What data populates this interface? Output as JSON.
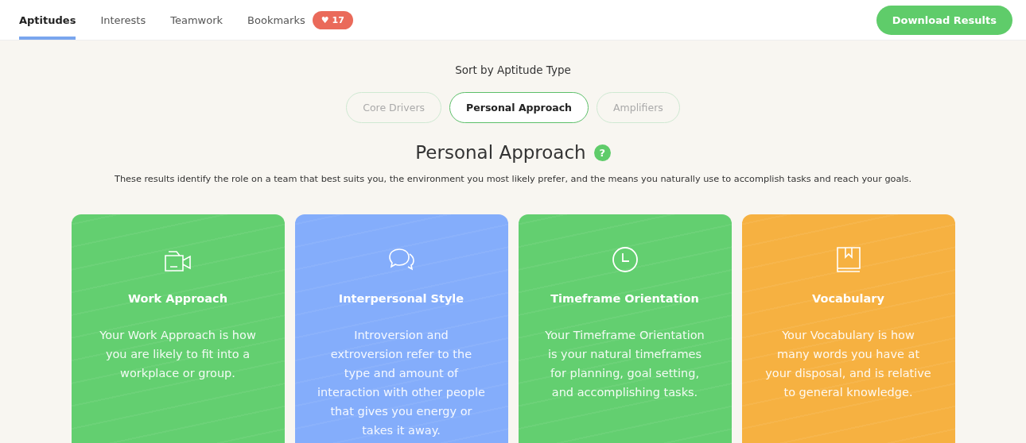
{
  "tabs": [
    {
      "label": "Aptitudes",
      "selected": true
    },
    {
      "label": "Interests",
      "selected": false
    },
    {
      "label": "Teamwork",
      "selected": false
    },
    {
      "label": "Bookmarks",
      "selected": false
    }
  ],
  "bookmarks_badge": {
    "icon": "♥",
    "count": "17"
  },
  "download_button": "Download Results",
  "sort": {
    "heading": "Sort by Aptitude Type",
    "options": [
      {
        "label": "Core Drivers",
        "selected": false
      },
      {
        "label": "Personal Approach",
        "selected": true
      },
      {
        "label": "Amplifiers",
        "selected": false
      }
    ]
  },
  "section": {
    "title": "Personal Approach",
    "help": "?",
    "description": "These results identify the role on a team that best suits you, the environment you most likely prefer, and the means you naturally use to accomplish tasks and reach your goals."
  },
  "cards": [
    {
      "kind": "camera",
      "color": "#63cf70",
      "title": "Work Approach",
      "text": "Your Work Approach is how you are likely to fit into a workplace or group."
    },
    {
      "kind": "chat",
      "color": "#84adfb",
      "title": "Interpersonal Style",
      "text": "Introversion and extroversion refer to the type and amount of interaction with other people that gives you energy or takes it away."
    },
    {
      "kind": "clock",
      "color": "#63cf70",
      "title": "Timeframe Orientation",
      "text": "Your Timeframe Orientation is your natural timeframes for planning, goal setting, and accomplishing tasks."
    },
    {
      "kind": "book",
      "color": "#f6b141",
      "title": "Vocabulary",
      "text": "Your Vocabulary is how many words you have at your disposal, and is relative to general knowledge."
    }
  ]
}
